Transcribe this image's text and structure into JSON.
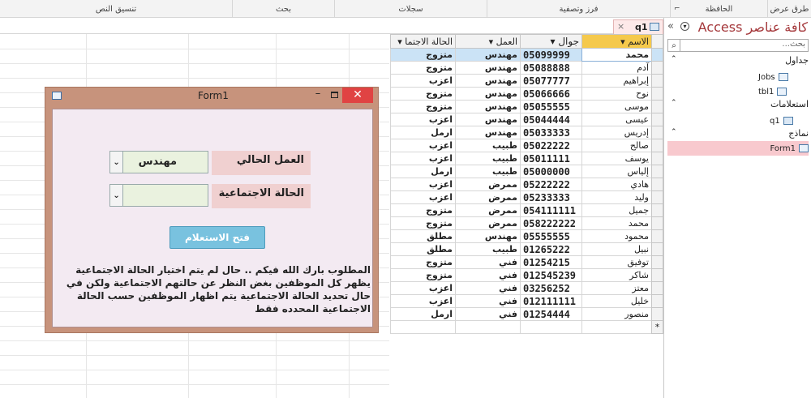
{
  "ribbon": {
    "groups": [
      "طرق عرض",
      "الحافظة",
      "فرز وتصفية",
      "سجلات",
      "بحث",
      "تنسيق النص"
    ]
  },
  "nav": {
    "title": "كافة عناصر Access",
    "search_placeholder": "بحث...",
    "collapse_glyph": "«",
    "sections": [
      {
        "label": "جداول",
        "items": [
          "Jobs",
          "tbl1"
        ]
      },
      {
        "label": "استعلامات",
        "items": [
          "q1"
        ]
      },
      {
        "label": "نماذج",
        "items": [
          "Form1"
        ]
      }
    ]
  },
  "query_tab": {
    "label": "q1",
    "close": "×"
  },
  "datasheet": {
    "headers": [
      "الاسم",
      "جوال",
      "العمل",
      "الحالة الاجتما"
    ],
    "rows": [
      [
        "محمد",
        "05099999",
        "مهندس",
        "متزوج"
      ],
      [
        "آدم",
        "05088888",
        "مهندس",
        "متزوج"
      ],
      [
        "إبراهيم",
        "05077777",
        "مهندس",
        "اعزب"
      ],
      [
        "نوح",
        "05066666",
        "مهندس",
        "متزوج"
      ],
      [
        "موسى",
        "05055555",
        "مهندس",
        "متزوج"
      ],
      [
        "عيسى",
        "05044444",
        "مهندس",
        "اعزب"
      ],
      [
        "إدريس",
        "05033333",
        "مهندس",
        "ارمل"
      ],
      [
        "صالح",
        "05022222",
        "طبيب",
        "اعزب"
      ],
      [
        "يوسف",
        "05011111",
        "طبيب",
        "اعزب"
      ],
      [
        "إلياس",
        "05000000",
        "طبيب",
        "ارمل"
      ],
      [
        "هادي",
        "05222222",
        "ممرض",
        "اعزب"
      ],
      [
        "وليد",
        "05233333",
        "ممرض",
        "اعزب"
      ],
      [
        "جميل",
        "054111111",
        "ممرض",
        "متزوج"
      ],
      [
        "محمد",
        "058222222",
        "ممرض",
        "متزوج"
      ],
      [
        "محمود",
        "05555555",
        "مهندس",
        "مطلق"
      ],
      [
        "نبيل",
        "01265222",
        "طبيب",
        "مطلق"
      ],
      [
        "توفيق",
        "01254215",
        "فني",
        "متزوج"
      ],
      [
        "شاكر",
        "012545239",
        "فني",
        "متزوج"
      ],
      [
        "معتز",
        "03256252",
        "فني",
        "اعزب"
      ],
      [
        "خليل",
        "012111111",
        "فني",
        "اعزب"
      ],
      [
        "منصور",
        "01254444",
        "فني",
        "ارمل"
      ]
    ],
    "new_row_marker": "*"
  },
  "form": {
    "title": "Form1",
    "job_label": "العمل الحالي",
    "job_value": "مهندس",
    "marital_label": "الحالة الاجتماعية",
    "marital_value": "",
    "button_label": "فتح الاستعلام",
    "note": "المطلوب بارك الله فيكم .. حال لم يتم اختيار الحالة الاجتماعية يظهر كل الموظفين بغض النظر عن حالتهم الاجتماعية  ولكن في حال تحديد الحالة الاجتماعية يتم اظهار الموظفين حسب الحالة الاجتماعية المحدده فقط"
  },
  "colors": {
    "accent": "#a4373a",
    "form_frame": "#c7937c",
    "button": "#79c2df",
    "close_button": "#e04343",
    "header_active": "#f5c94c"
  }
}
